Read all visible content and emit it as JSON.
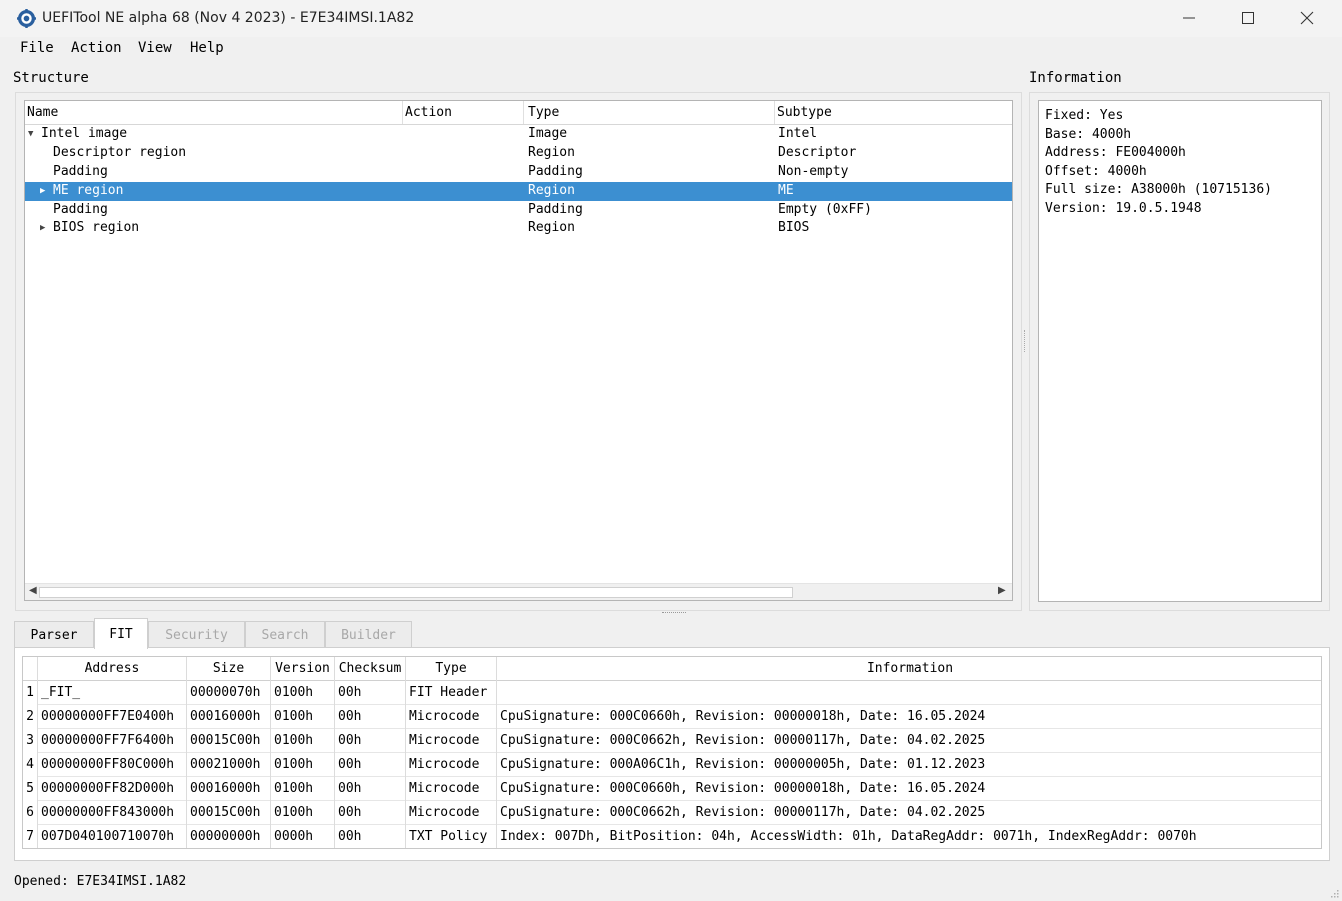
{
  "window": {
    "title": "UEFITool NE alpha 68 (Nov  4 2023) - E7E34IMSI.1A82"
  },
  "menu": {
    "file": "File",
    "action": "Action",
    "view": "View",
    "help": "Help"
  },
  "structure": {
    "label": "Structure",
    "columns": [
      "Name",
      "Action",
      "Type",
      "Subtype"
    ],
    "rows": [
      {
        "name": "Intel image",
        "action": "",
        "type": "Image",
        "subtype": "Intel",
        "expander": "expanded",
        "depth": 0,
        "selected": false
      },
      {
        "name": "Descriptor region",
        "action": "",
        "type": "Region",
        "subtype": "Descriptor",
        "expander": "none",
        "depth": 1,
        "selected": false
      },
      {
        "name": "Padding",
        "action": "",
        "type": "Padding",
        "subtype": "Non-empty",
        "expander": "none",
        "depth": 1,
        "selected": false
      },
      {
        "name": "ME region",
        "action": "",
        "type": "Region",
        "subtype": "ME",
        "expander": "collapsed",
        "depth": 1,
        "selected": true
      },
      {
        "name": "Padding",
        "action": "",
        "type": "Padding",
        "subtype": "Empty (0xFF)",
        "expander": "none",
        "depth": 1,
        "selected": false
      },
      {
        "name": "BIOS region",
        "action": "",
        "type": "Region",
        "subtype": "BIOS",
        "expander": "collapsed",
        "depth": 1,
        "selected": false
      }
    ]
  },
  "information": {
    "label": "Information",
    "lines": [
      "Fixed: Yes",
      "Base: 4000h",
      "Address: FE004000h",
      "Offset: 4000h",
      "Full size: A38000h (10715136)",
      "Version: 19.0.5.1948"
    ]
  },
  "tabs": [
    {
      "label": "Parser",
      "active": false,
      "disabled": false
    },
    {
      "label": "FIT",
      "active": true,
      "disabled": false
    },
    {
      "label": "Security",
      "active": false,
      "disabled": true
    },
    {
      "label": "Search",
      "active": false,
      "disabled": true
    },
    {
      "label": "Builder",
      "active": false,
      "disabled": true
    }
  ],
  "fit": {
    "columns": [
      "Address",
      "Size",
      "Version",
      "Checksum",
      "Type",
      "Information"
    ],
    "rows": [
      {
        "num": "1",
        "address": "_FIT_",
        "size": "00000070h",
        "version": "0100h",
        "checksum": "00h",
        "type": "FIT Header",
        "info": ""
      },
      {
        "num": "2",
        "address": "00000000FF7E0400h",
        "size": "00016000h",
        "version": "0100h",
        "checksum": "00h",
        "type": "Microcode",
        "info": "CpuSignature: 000C0660h, Revision: 00000018h, Date: 16.05.2024"
      },
      {
        "num": "3",
        "address": "00000000FF7F6400h",
        "size": "00015C00h",
        "version": "0100h",
        "checksum": "00h",
        "type": "Microcode",
        "info": "CpuSignature: 000C0662h, Revision: 00000117h, Date: 04.02.2025"
      },
      {
        "num": "4",
        "address": "00000000FF80C000h",
        "size": "00021000h",
        "version": "0100h",
        "checksum": "00h",
        "type": "Microcode",
        "info": "CpuSignature: 000A06C1h, Revision: 00000005h, Date: 01.12.2023"
      },
      {
        "num": "5",
        "address": "00000000FF82D000h",
        "size": "00016000h",
        "version": "0100h",
        "checksum": "00h",
        "type": "Microcode",
        "info": "CpuSignature: 000C0660h, Revision: 00000018h, Date: 16.05.2024"
      },
      {
        "num": "6",
        "address": "00000000FF843000h",
        "size": "00015C00h",
        "version": "0100h",
        "checksum": "00h",
        "type": "Microcode",
        "info": "CpuSignature: 000C0662h, Revision: 00000117h, Date: 04.02.2025"
      },
      {
        "num": "7",
        "address": "007D040100710070h",
        "size": "00000000h",
        "version": "0000h",
        "checksum": "00h",
        "type": "TXT Policy",
        "info": "Index: 007Dh, BitPosition: 04h, AccessWidth: 01h, DataRegAddr: 0071h, IndexRegAddr: 0070h"
      }
    ]
  },
  "status": {
    "text": "Opened: E7E34IMSI.1A82"
  },
  "colors": {
    "selection": "#3c8fd1"
  }
}
